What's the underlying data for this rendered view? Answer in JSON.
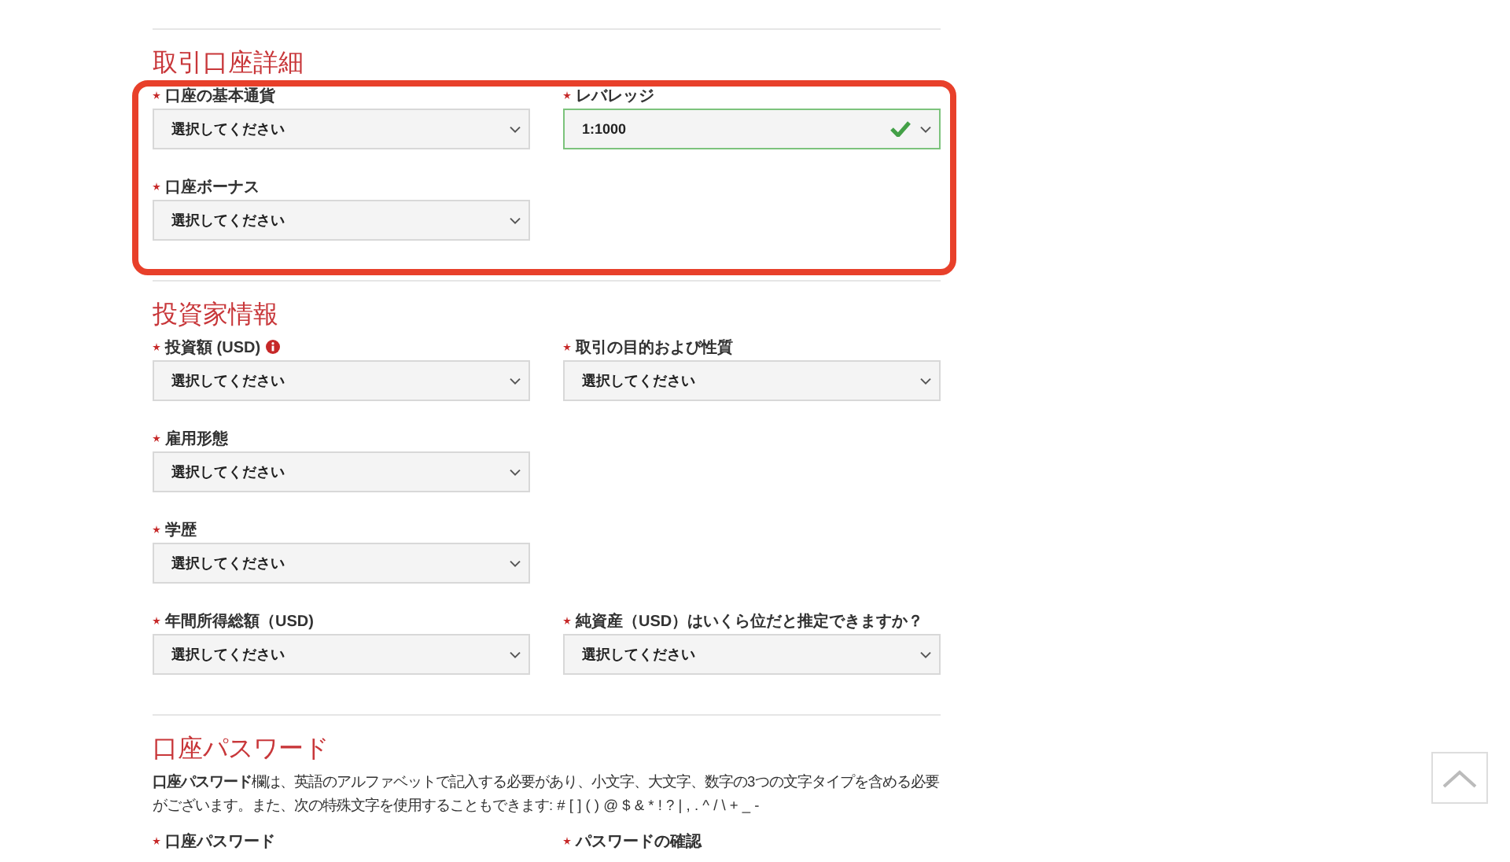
{
  "sections": [
    {
      "title": "取引口座詳細",
      "frame": true,
      "rows": [
        [
          {
            "label": "口座の基本通貨",
            "value": "選択してください",
            "valid": false
          },
          {
            "label": "レバレッジ",
            "value": "1:1000",
            "valid": true
          }
        ],
        [
          {
            "label": "口座ボーナス",
            "value": "選択してください",
            "valid": false
          }
        ]
      ]
    },
    {
      "title": "投資家情報",
      "rows": [
        [
          {
            "label": "投資額 (USD)",
            "info_icon": true,
            "value": "選択してください",
            "valid": false
          },
          {
            "label": "取引の目的および性質",
            "value": "選択してください",
            "valid": false
          }
        ],
        [
          {
            "label": "雇用形態",
            "value": "選択してください",
            "valid": false
          }
        ],
        [
          {
            "label": "学歴",
            "value": "選択してください",
            "valid": false
          }
        ],
        [
          {
            "label": "年間所得総額（USD)",
            "value": "選択してください",
            "valid": false
          },
          {
            "label": "純資産（USD）はいくら位だと推定できますか？",
            "value": "選択してください",
            "valid": false
          }
        ]
      ]
    },
    {
      "title": "口座パスワード",
      "description": "**口座パスワード**欄は、英語のアルファベットで記入する必要があり、小文字、大文字、数字の3つの文字タイプを含める必要がございます。また、次の特殊文字を使用することもできます: # [ ] ( ) @ $ & * ! ? | , . ^ / \\ + _ -",
      "rows": [
        [
          {
            "label": "口座パスワード"
          },
          {
            "label": "パスワードの確認"
          }
        ]
      ]
    }
  ]
}
